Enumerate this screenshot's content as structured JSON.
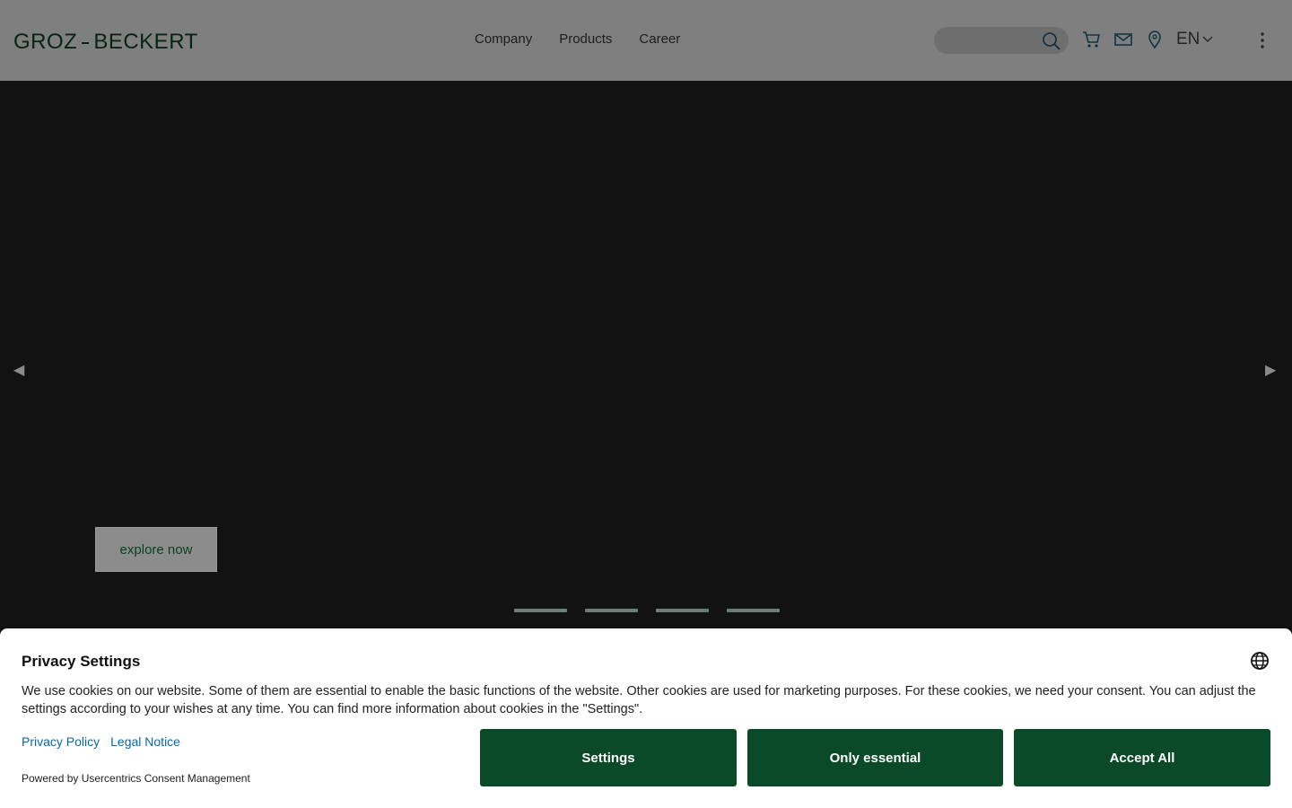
{
  "header": {
    "logo_left": "GROZ",
    "logo_right": "BECKERT",
    "nav": [
      "Company",
      "Products",
      "Career"
    ],
    "search_icon": "search-icon",
    "cart_icon": "cart-icon",
    "mail_icon": "mail-icon",
    "location_icon": "location-pin-icon",
    "language": "EN",
    "menu_icon": "kebab-menu-icon"
  },
  "hero": {
    "prev_arrow": "◀",
    "next_arrow": "▶",
    "cta_label": "explore now",
    "slide_count": 4
  },
  "consent": {
    "title": "Privacy Settings",
    "text": "We use cookies on our website. Some of them are essential to enable the basic functions of the website. Other cookies are used for marketing purposes. For these cookies, we need your consent. You can adjust the settings according to your wishes at any time. You can find more information about cookies in the \"Settings\".",
    "privacy_link": "Privacy Policy",
    "legal_link": "Legal Notice",
    "powered": "Powered by Usercentrics Consent Management",
    "settings_label": "Settings",
    "essential_label": "Only essential",
    "accept_label": "Accept All"
  },
  "colors": {
    "brand_green": "#0b4a28",
    "link_blue": "#0a66a8"
  }
}
